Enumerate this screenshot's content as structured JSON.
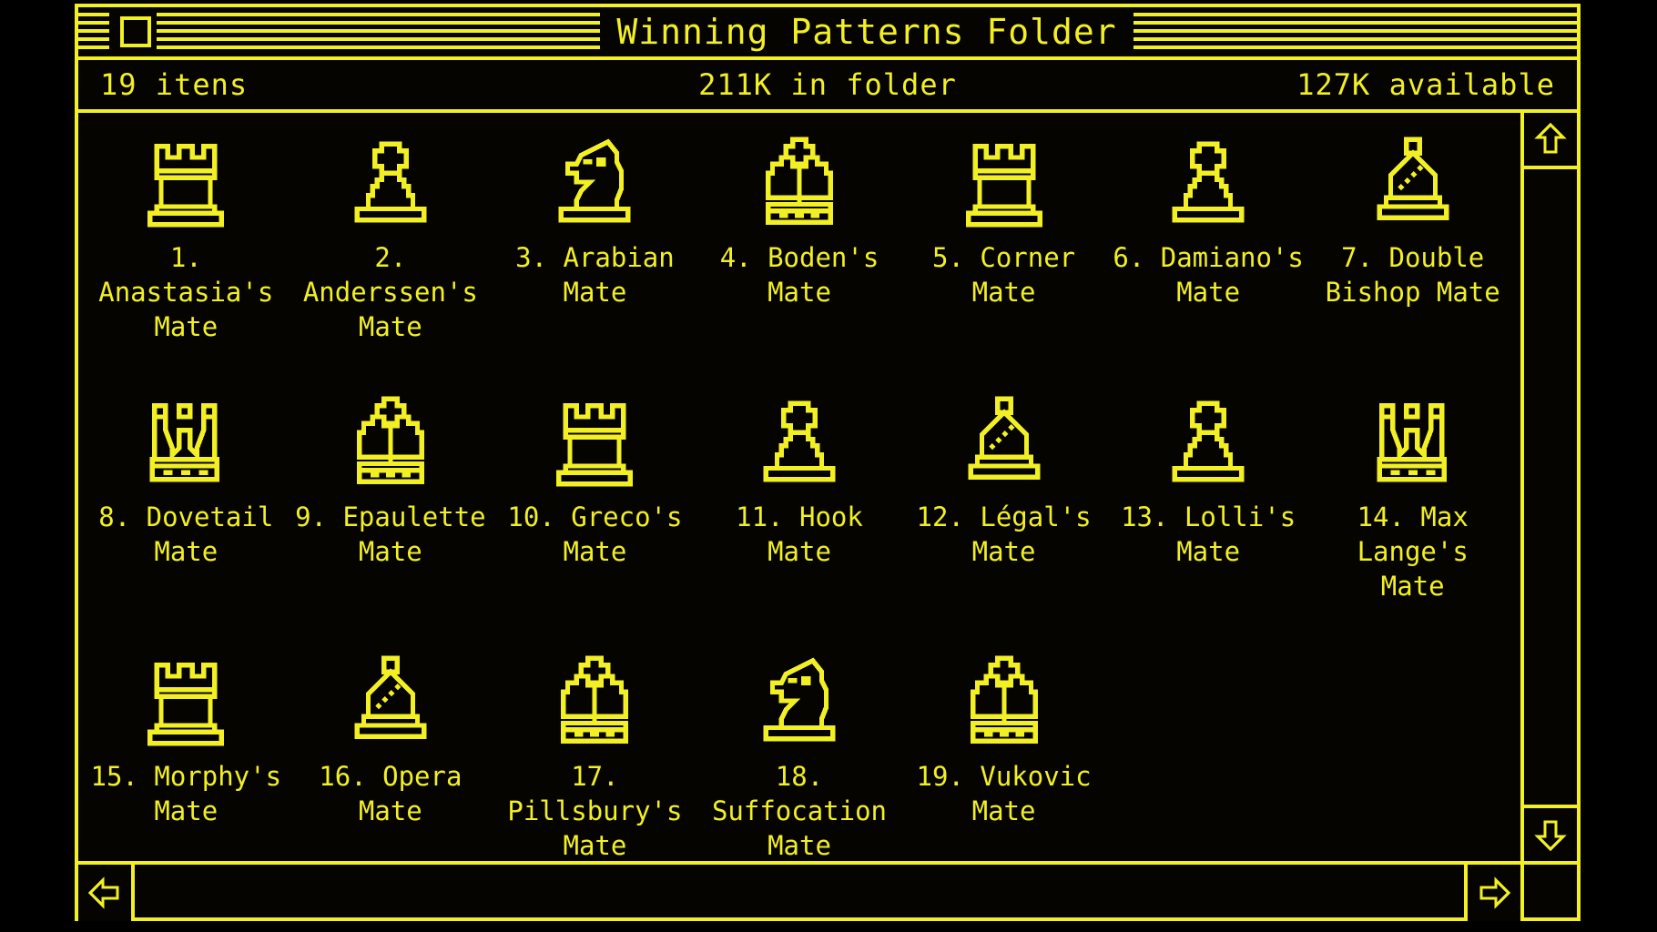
{
  "window": {
    "title": "Winning Patterns Folder",
    "close_box": "close-box",
    "theme_color": "#F2F024",
    "background_color": "#000000"
  },
  "info_bar": {
    "item_count": "19 itens",
    "folder_size": "211K in folder",
    "available": "127K available"
  },
  "scrollbars": {
    "up_arrow": "scroll-up",
    "down_arrow": "scroll-down",
    "left_arrow": "scroll-left",
    "right_arrow": "scroll-right"
  },
  "items": [
    {
      "label": "1. Anastasia's\nMate",
      "icon": "rook-icon"
    },
    {
      "label": "2. Anderssen's\nMate",
      "icon": "pawn-icon"
    },
    {
      "label": "3. Arabian Mate",
      "icon": "knight-icon"
    },
    {
      "label": "4. Boden's Mate",
      "icon": "king-icon"
    },
    {
      "label": "5. Corner Mate",
      "icon": "rook-icon"
    },
    {
      "label": "6. Damiano's\nMate",
      "icon": "pawn-icon"
    },
    {
      "label": "7. Double\nBishop Mate",
      "icon": "bishop-icon"
    },
    {
      "label": "8. Dovetail\nMate",
      "icon": "queen-icon"
    },
    {
      "label": "9. Epaulette\nMate",
      "icon": "king-icon"
    },
    {
      "label": "10. Greco's\nMate",
      "icon": "rook-icon"
    },
    {
      "label": "11. Hook Mate",
      "icon": "pawn-icon"
    },
    {
      "label": "12. Légal's\nMate",
      "icon": "bishop-icon"
    },
    {
      "label": "13. Lolli's Mate",
      "icon": "pawn-icon"
    },
    {
      "label": "14. Max Lange's\nMate",
      "icon": "queen-icon"
    },
    {
      "label": "15. Morphy's\nMate",
      "icon": "rook-icon"
    },
    {
      "label": "16. Opera Mate",
      "icon": "bishop-icon"
    },
    {
      "label": "17. Pillsbury's\nMate",
      "icon": "king-icon"
    },
    {
      "label": "18. Suffocation\nMate",
      "icon": "knight-icon"
    },
    {
      "label": "19. Vukovic\nMate",
      "icon": "king-icon"
    }
  ]
}
